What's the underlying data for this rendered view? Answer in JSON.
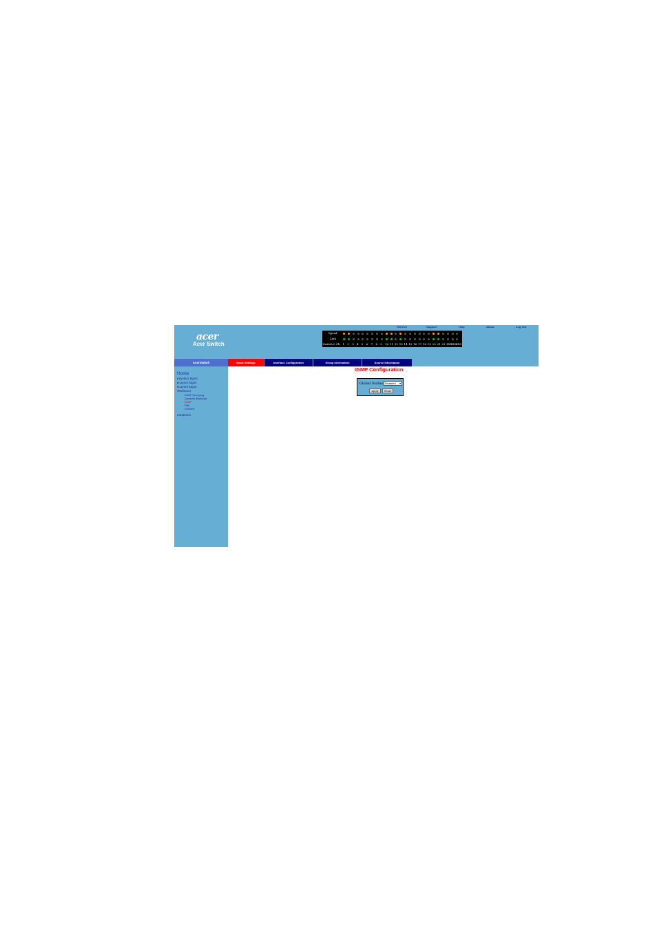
{
  "header": {
    "logo": "acer",
    "product": "Acer Switch",
    "links": [
      "Refresh",
      "Support",
      "Help",
      "About",
      "Log Out"
    ]
  },
  "panel": {
    "speed_label": "Speed",
    "link_label": "Link",
    "switch_label": "Switch 0  Ch",
    "ports": [
      "1",
      "2",
      "3",
      "4",
      "5",
      "6",
      "7",
      "8",
      "9",
      "10",
      "11",
      "12",
      "13",
      "14",
      "15",
      "16",
      "17",
      "18",
      "19",
      "20",
      "21",
      "22",
      "SX1",
      "SX2",
      "SX3"
    ]
  },
  "sidebar": {
    "header": "AcerSwitch",
    "home": "Home",
    "items": [
      "System Mgmt",
      "Layer2 Mgmt",
      "Layer3 Mgmt",
      "Multicast"
    ],
    "multicast_sub": [
      "IGMP Snooping",
      "Dynamic Multicast",
      "IGMP",
      "PIM",
      "DVMRP"
    ],
    "statistics": "Statistics"
  },
  "tabs": [
    "Basic Settings",
    "Interface Configuration",
    "Group Information",
    "Source Information"
  ],
  "content": {
    "title": "IGMP Configuration",
    "global_status_label": "Global Status",
    "global_status_value": "Disabled",
    "apply_label": "Apply",
    "reset_label": "Reset"
  },
  "colors": {
    "background": "#66aed4",
    "active_tab": "#ff0000",
    "inactive_tab": "#00007f",
    "sidebar_header": "#4f6fd0",
    "link": "#1e2c9b",
    "led_orange": "#ff9900",
    "led_green": "#00cc00",
    "led_off": "#555555"
  },
  "led_state": {
    "speed": [
      "orange",
      "orange",
      "off",
      "off",
      "off",
      "off",
      "off",
      "off",
      "off",
      "orange",
      "orange",
      "off",
      "orange",
      "off",
      "off",
      "off",
      "off",
      "off",
      "off",
      "orange",
      "orange",
      "off",
      "off",
      "off",
      "off"
    ],
    "link": [
      "green",
      "green",
      "off",
      "off",
      "off",
      "off",
      "off",
      "off",
      "off",
      "green",
      "green",
      "off",
      "green",
      "off",
      "off",
      "off",
      "off",
      "off",
      "off",
      "green",
      "green",
      "off",
      "off",
      "off",
      "off"
    ]
  }
}
